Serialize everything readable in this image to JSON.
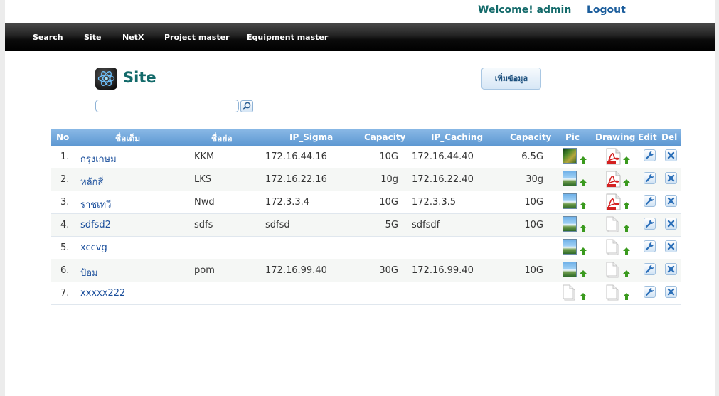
{
  "header": {
    "welcome": "Welcome! admin",
    "logout": "Logout"
  },
  "nav": {
    "items": [
      "Search",
      "Site",
      "NetX",
      "Project master",
      "Equipment master"
    ]
  },
  "page": {
    "title": "Site",
    "search_placeholder": "",
    "add_button": "เพิ่มข้อมูล"
  },
  "table": {
    "columns": [
      "No",
      "ชื่อเต็ม",
      "ชื่อย่อ",
      "IP_Sigma",
      "Capacity",
      "IP_Caching",
      "Capacity",
      "Pic",
      "Drawing",
      "Edit",
      "Del"
    ],
    "rows": [
      {
        "no": "1.",
        "full_name": "กรุงเกษม",
        "short_name": "KKM",
        "ip_sigma": "172.16.44.16",
        "capacity_sigma": "10G",
        "ip_caching": "172.16.44.40",
        "capacity_caching": "6.5G",
        "pic": "photo",
        "drawing": "pdf"
      },
      {
        "no": "2.",
        "full_name": "หลักสี่",
        "short_name": "LKS",
        "ip_sigma": "172.16.22.16",
        "capacity_sigma": "10g",
        "ip_caching": "172.16.22.40",
        "capacity_caching": "30g",
        "pic": "image",
        "drawing": "pdf"
      },
      {
        "no": "3.",
        "full_name": "ราชเทวี",
        "short_name": "Nwd",
        "ip_sigma": "172.3.3.4",
        "capacity_sigma": "10G",
        "ip_caching": "172.3.3.5",
        "capacity_caching": "10G",
        "pic": "image",
        "drawing": "pdf"
      },
      {
        "no": "4.",
        "full_name": "sdfsd2",
        "short_name": "sdfs",
        "ip_sigma": "sdfsd",
        "capacity_sigma": "5G",
        "ip_caching": "sdfsdf",
        "capacity_caching": "10G",
        "pic": "image",
        "drawing": "blank"
      },
      {
        "no": "5.",
        "full_name": "xccvg",
        "short_name": "",
        "ip_sigma": "",
        "capacity_sigma": "",
        "ip_caching": "",
        "capacity_caching": "",
        "pic": "image",
        "drawing": "blank"
      },
      {
        "no": "6.",
        "full_name": "ป้อม",
        "short_name": "pom",
        "ip_sigma": "172.16.99.40",
        "capacity_sigma": "30G",
        "ip_caching": "172.16.99.40",
        "capacity_caching": "10G",
        "pic": "image",
        "drawing": "blank"
      },
      {
        "no": "7.",
        "full_name": "xxxxx222",
        "short_name": "",
        "ip_sigma": "",
        "capacity_sigma": "",
        "ip_caching": "",
        "capacity_caching": "",
        "pic": "blank",
        "drawing": "blank"
      }
    ]
  },
  "icons": {
    "site_icon": "atom-icon",
    "search_button": "magnifier-icon",
    "upload": "upload-arrow-icon",
    "edit": "wrench-icon",
    "delete": "close-x-icon",
    "pdf": "pdf-file-icon",
    "blank": "blank-file-icon",
    "image": "image-file-icon"
  },
  "colors": {
    "title": "#136a6a",
    "link": "#1b4f9c",
    "header_bar": "#5d98d2",
    "upload_arrow": "#3a9a1e"
  }
}
